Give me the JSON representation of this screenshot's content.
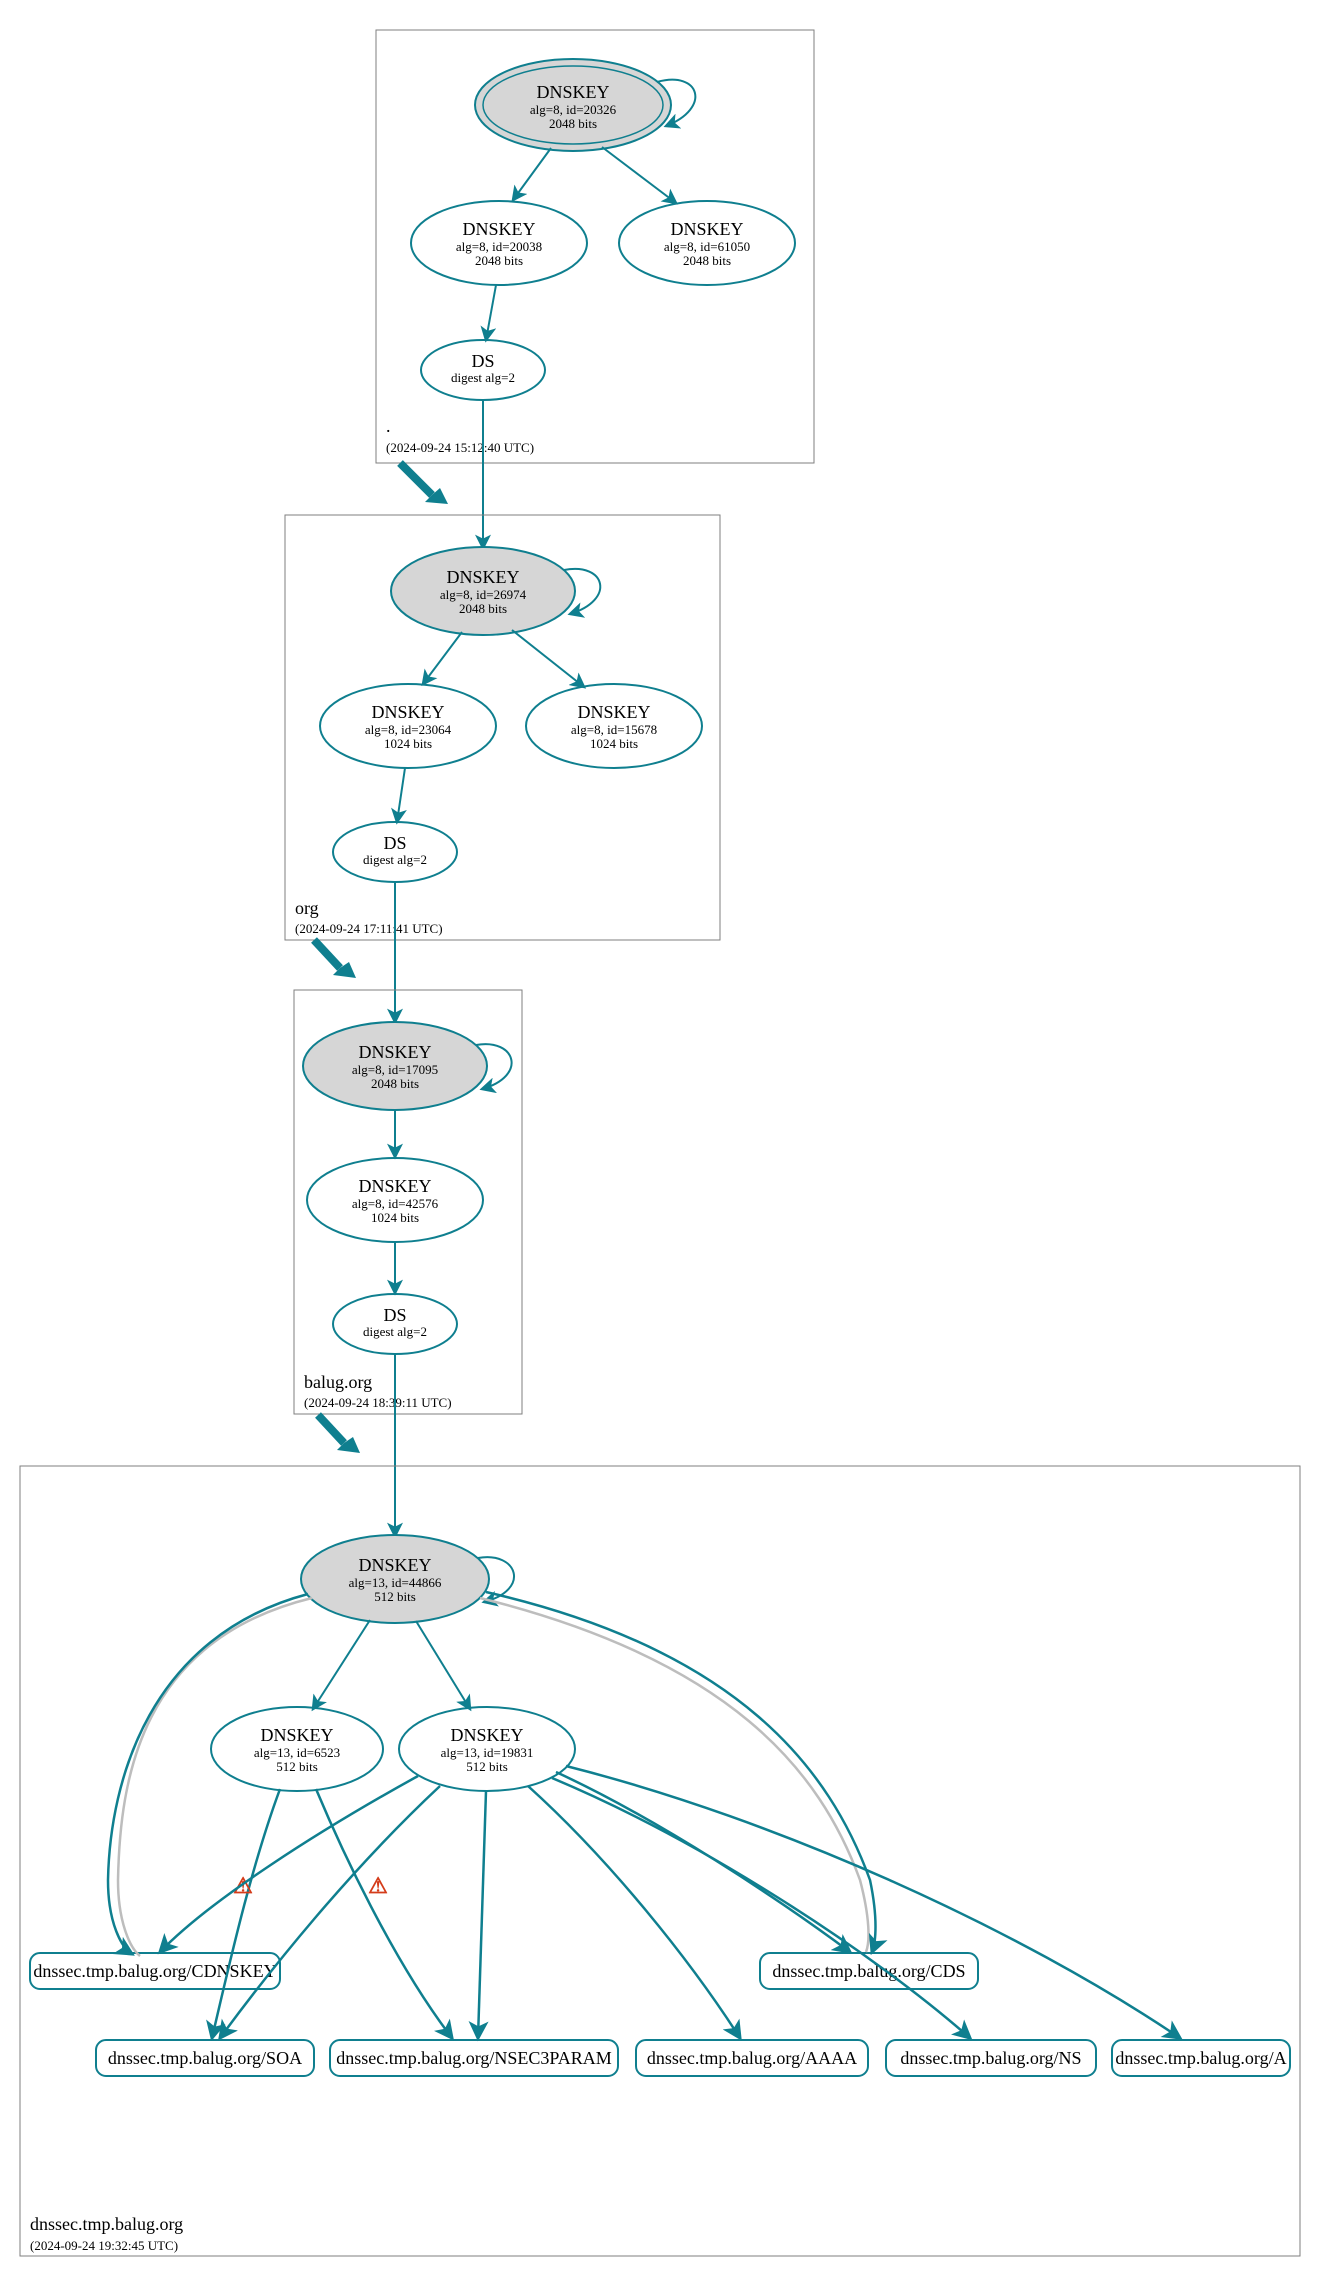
{
  "colors": {
    "teal": "#0f7f8f",
    "ksk_fill": "#d6d6d6",
    "box": "#7f7f7f",
    "warn": "#d43c1a",
    "grey_edge": "#bdbdbd"
  },
  "zones": {
    "root": {
      "name": ".",
      "timestamp": "(2024-09-24 15:12:40 UTC)"
    },
    "org": {
      "name": "org",
      "timestamp": "(2024-09-24 17:11:41 UTC)"
    },
    "balug": {
      "name": "balug.org",
      "timestamp": "(2024-09-24 18:39:11 UTC)"
    },
    "leaf": {
      "name": "dnssec.tmp.balug.org",
      "timestamp": "(2024-09-24 19:32:45 UTC)"
    }
  },
  "nodes": {
    "root_ksk": {
      "title": "DNSKEY",
      "sub1": "alg=8, id=20326",
      "sub2": "2048 bits"
    },
    "root_zsk1": {
      "title": "DNSKEY",
      "sub1": "alg=8, id=20038",
      "sub2": "2048 bits"
    },
    "root_zsk2": {
      "title": "DNSKEY",
      "sub1": "alg=8, id=61050",
      "sub2": "2048 bits"
    },
    "root_ds": {
      "title": "DS",
      "sub1": "digest alg=2"
    },
    "org_ksk": {
      "title": "DNSKEY",
      "sub1": "alg=8, id=26974",
      "sub2": "2048 bits"
    },
    "org_zsk1": {
      "title": "DNSKEY",
      "sub1": "alg=8, id=23064",
      "sub2": "1024 bits"
    },
    "org_zsk2": {
      "title": "DNSKEY",
      "sub1": "alg=8, id=15678",
      "sub2": "1024 bits"
    },
    "org_ds": {
      "title": "DS",
      "sub1": "digest alg=2"
    },
    "balug_ksk": {
      "title": "DNSKEY",
      "sub1": "alg=8, id=17095",
      "sub2": "2048 bits"
    },
    "balug_zsk": {
      "title": "DNSKEY",
      "sub1": "alg=8, id=42576",
      "sub2": "1024 bits"
    },
    "balug_ds": {
      "title": "DS",
      "sub1": "digest alg=2"
    },
    "leaf_ksk": {
      "title": "DNSKEY",
      "sub1": "alg=13, id=44866",
      "sub2": "512 bits"
    },
    "leaf_zsk1": {
      "title": "DNSKEY",
      "sub1": "alg=13, id=6523",
      "sub2": "512 bits"
    },
    "leaf_zsk2": {
      "title": "DNSKEY",
      "sub1": "alg=13, id=19831",
      "sub2": "512 bits"
    }
  },
  "rrsets": {
    "cdnskey": "dnssec.tmp.balug.org/CDNSKEY",
    "soa": "dnssec.tmp.balug.org/SOA",
    "nsec3param": "dnssec.tmp.balug.org/NSEC3PARAM",
    "cds": "dnssec.tmp.balug.org/CDS",
    "aaaa": "dnssec.tmp.balug.org/AAAA",
    "ns": "dnssec.tmp.balug.org/NS",
    "a": "dnssec.tmp.balug.org/A"
  },
  "icons": {
    "warning": "⚠"
  }
}
